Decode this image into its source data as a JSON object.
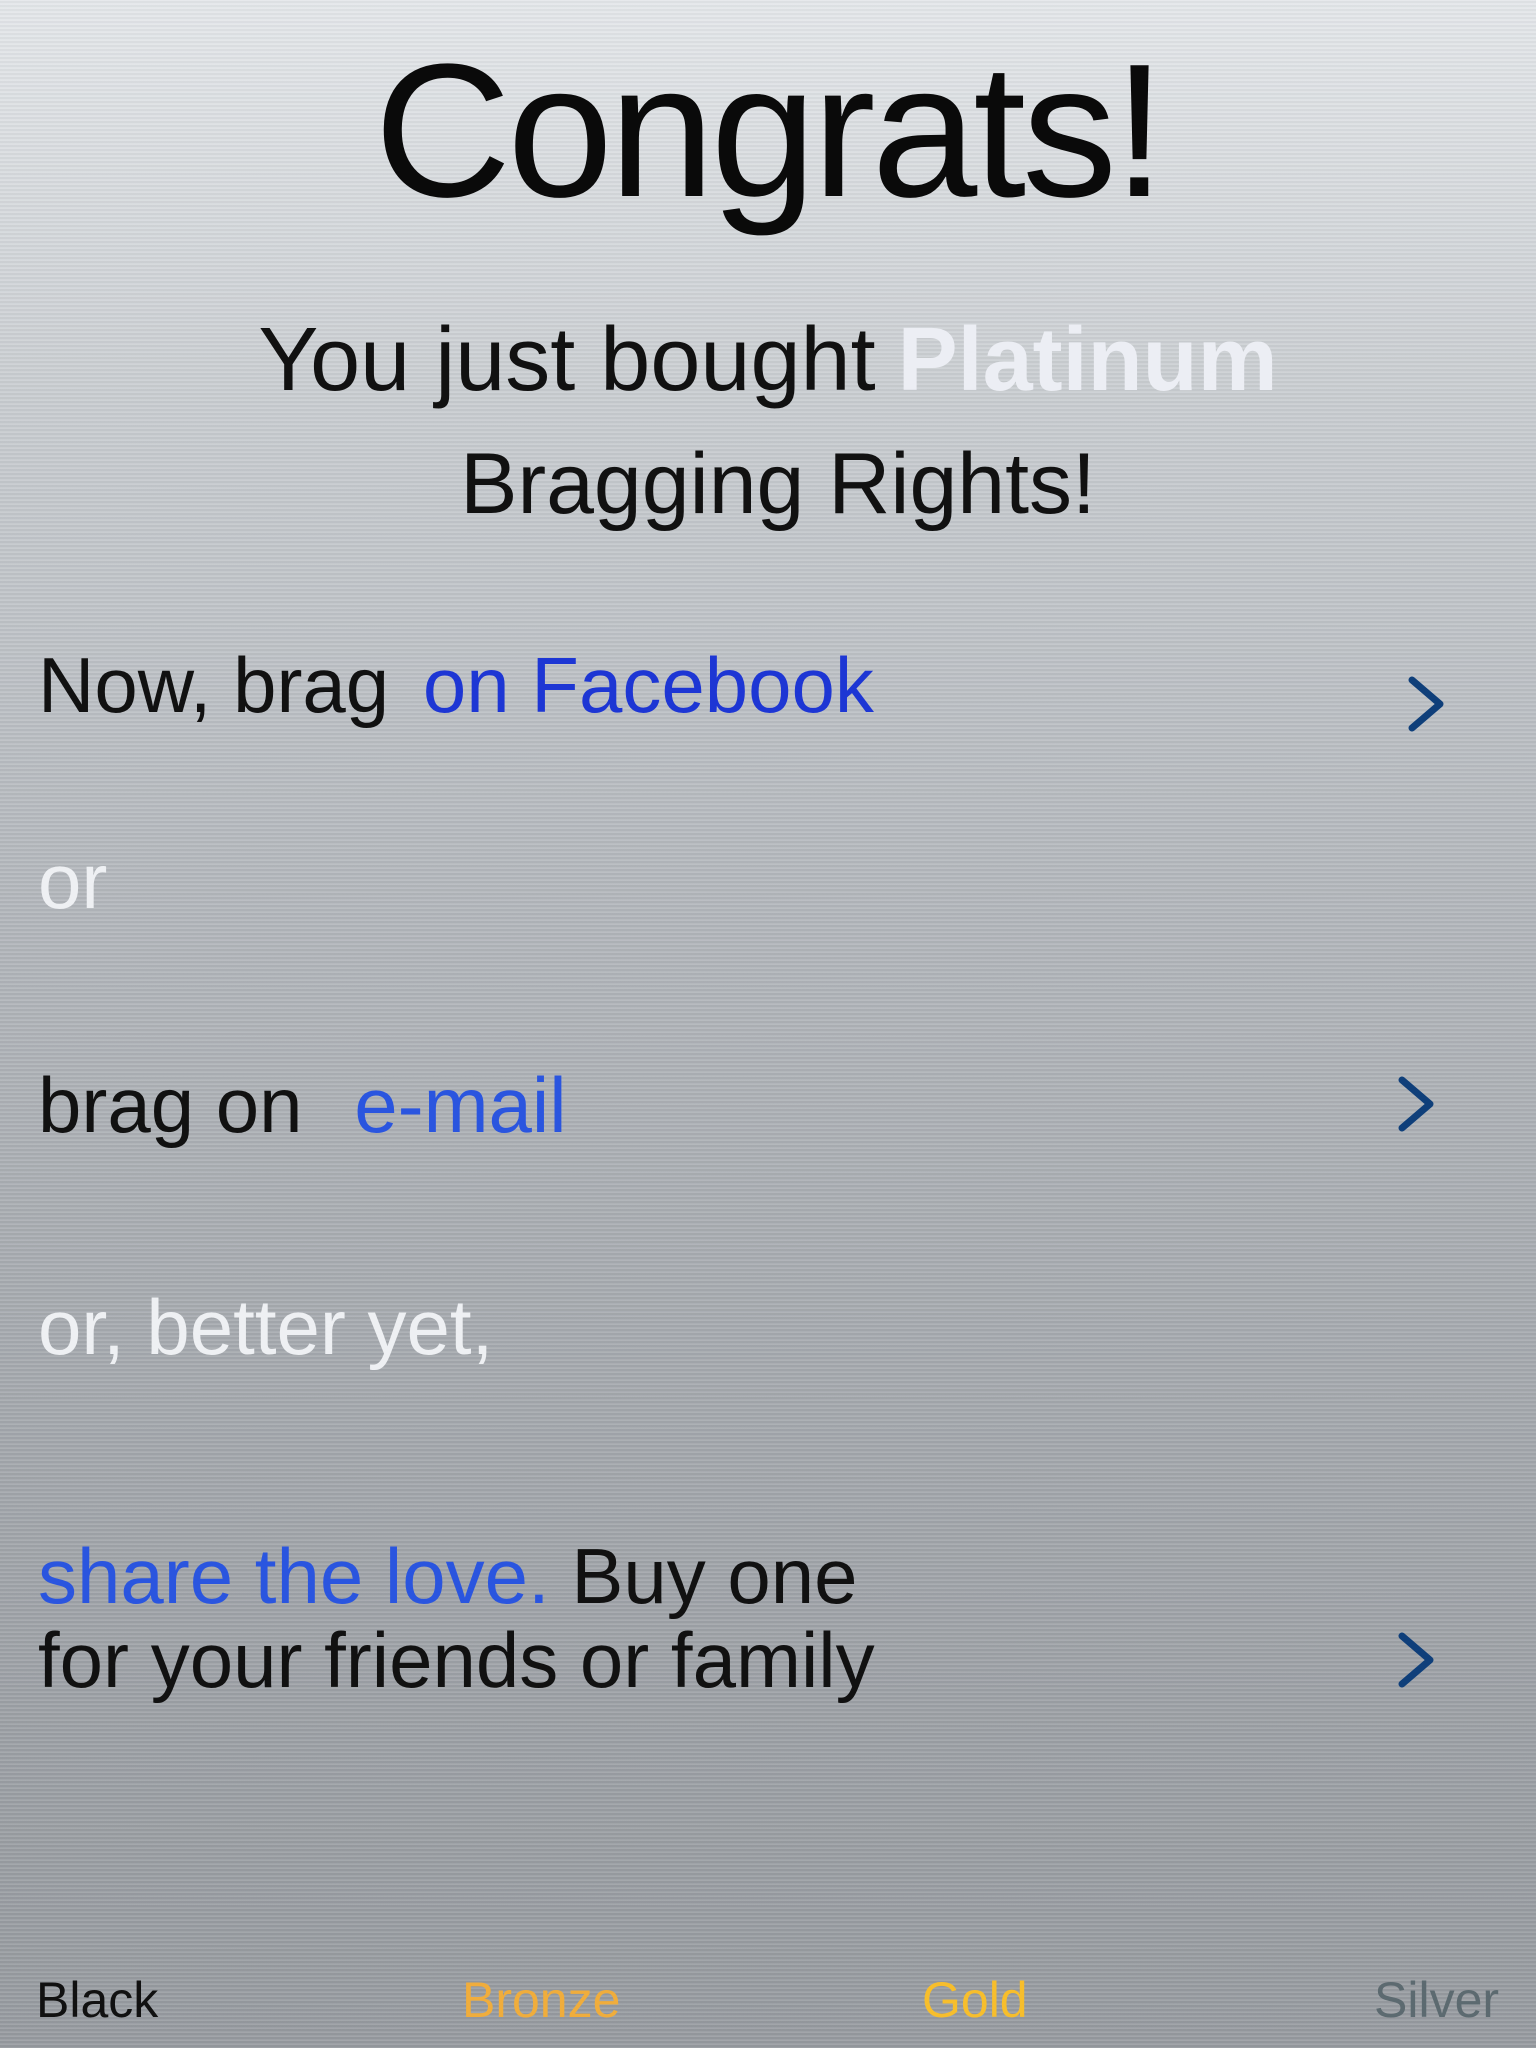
{
  "header": {
    "title": "Congrats!",
    "subtitle_prefix": "You just bought",
    "tier": "Platinum",
    "subtitle_suffix": "Bragging Rights!"
  },
  "actions": {
    "facebook": {
      "prefix": "Now, brag",
      "link": "on Facebook",
      "icon": "chevron-right-icon"
    },
    "or_1": "or",
    "email": {
      "prefix": "brag on",
      "link": "e-mail",
      "icon": "chevron-right-icon"
    },
    "or_2": "or, better yet,",
    "gift": {
      "link": "share the love.",
      "line1_rest": "Buy one",
      "line2": "for your friends or family",
      "icon": "chevron-right-icon"
    }
  },
  "tabs": [
    {
      "label": "Black",
      "color": "#111111"
    },
    {
      "label": "Bronze",
      "color": "#f0ad3c"
    },
    {
      "label": "Gold",
      "color": "#f7be2c"
    },
    {
      "label": "Silver",
      "color": "#5c6a70"
    }
  ],
  "colors": {
    "link_facebook": "#1d36d4",
    "link_email": "#2a55df",
    "chevron": "#0f3f7a",
    "tier_text": "#eceef4"
  }
}
